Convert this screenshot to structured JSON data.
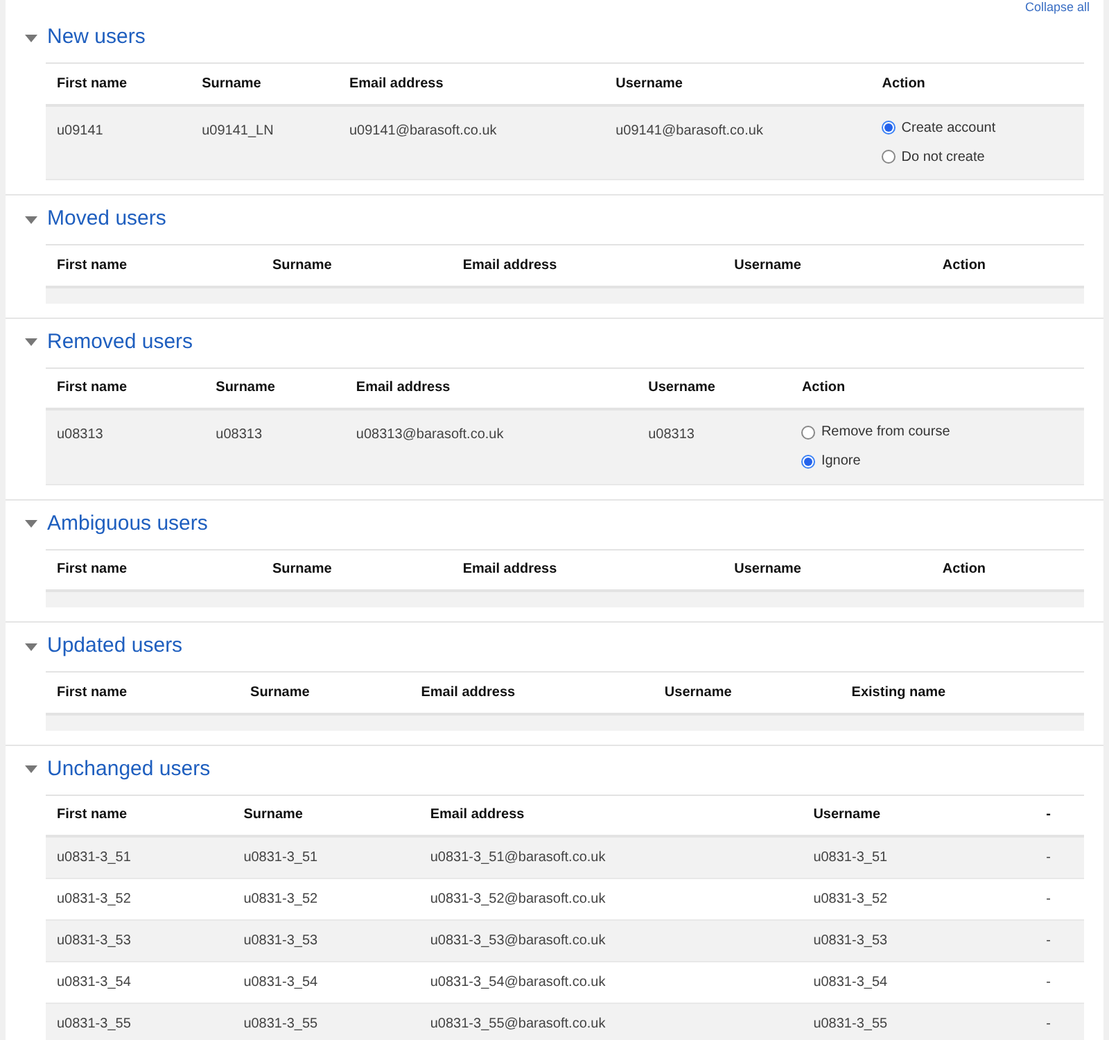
{
  "collapse_link": "Collapse all",
  "sections": [
    {
      "title": "New users",
      "expanded": true,
      "columns": [
        "First name",
        "Surname",
        "Email address",
        "Username",
        "Action"
      ],
      "rows": [
        {
          "cells": [
            "u09141",
            "u09141_LN",
            "u09141@barasoft.co.uk",
            "u09141@barasoft.co.uk"
          ],
          "options": [
            {
              "label": "Create account",
              "selected": true
            },
            {
              "label": "Do not create",
              "selected": false
            }
          ]
        }
      ]
    },
    {
      "title": "Moved users",
      "expanded": true,
      "columns": [
        "First name",
        "Surname",
        "Email address",
        "Username",
        "Action"
      ]
    },
    {
      "title": "Removed users",
      "expanded": true,
      "columns": [
        "First name",
        "Surname",
        "Email address",
        "Username",
        "Action"
      ],
      "rows": [
        {
          "cells": [
            "u08313",
            "u08313",
            "u08313@barasoft.co.uk",
            "u08313"
          ],
          "options": [
            {
              "label": "Remove from course",
              "selected": false
            },
            {
              "label": "Ignore",
              "selected": true
            }
          ]
        }
      ]
    },
    {
      "title": "Ambiguous users",
      "expanded": true,
      "columns": [
        "First name",
        "Surname",
        "Email address",
        "Username",
        "Action"
      ]
    },
    {
      "title": "Updated users",
      "expanded": true,
      "columns": [
        "First name",
        "Surname",
        "Email address",
        "Username",
        "Existing name"
      ]
    },
    {
      "title": "Unchanged users",
      "expanded": true,
      "columns": [
        "First name",
        "Surname",
        "Email address",
        "Username",
        "-"
      ],
      "rows": [
        {
          "cells": [
            "u0831-3_51",
            "u0831-3_51",
            "u0831-3_51@barasoft.co.uk",
            "u0831-3_51",
            "-"
          ]
        },
        {
          "cells": [
            "u0831-3_52",
            "u0831-3_52",
            "u0831-3_52@barasoft.co.uk",
            "u0831-3_52",
            "-"
          ]
        },
        {
          "cells": [
            "u0831-3_53",
            "u0831-3_53",
            "u0831-3_53@barasoft.co.uk",
            "u0831-3_53",
            "-"
          ]
        },
        {
          "cells": [
            "u0831-3_54",
            "u0831-3_54",
            "u0831-3_54@barasoft.co.uk",
            "u0831-3_54",
            "-"
          ]
        },
        {
          "cells": [
            "u0831-3_55",
            "u0831-3_55",
            "u0831-3_55@barasoft.co.uk",
            "u0831-3_55",
            "-"
          ]
        }
      ]
    }
  ]
}
